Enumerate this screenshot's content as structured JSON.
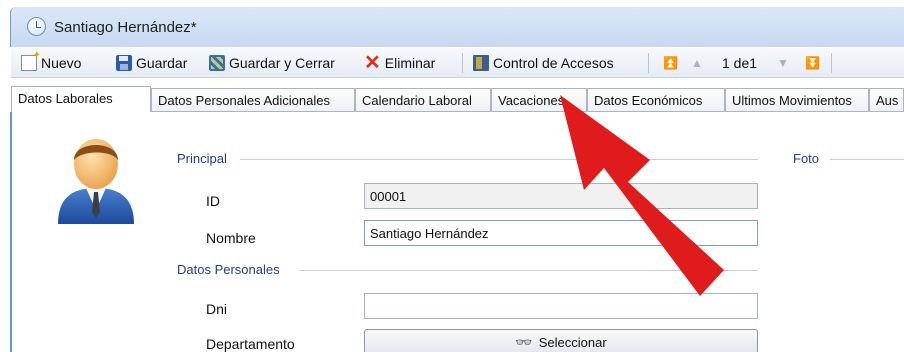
{
  "window": {
    "title": "Santiago Hernández*"
  },
  "toolbar": {
    "nuevo": "Nuevo",
    "guardar": "Guardar",
    "guardar_cerrar": "Guardar y Cerrar",
    "eliminar": "Eliminar",
    "control_accesos": "Control de Accesos",
    "page_indicator": "1 de1"
  },
  "tabs": [
    {
      "label": "Datos Laborales"
    },
    {
      "label": "Datos Personales Adicionales"
    },
    {
      "label": "Calendario Laboral"
    },
    {
      "label": "Vacaciones"
    },
    {
      "label": "Datos Económicos"
    },
    {
      "label": "Ultimos Movimientos"
    },
    {
      "label": "Aus"
    }
  ],
  "form": {
    "principal_group": "Principal",
    "foto_group": "Foto",
    "id_label": "ID",
    "id_value": "00001",
    "nombre_label": "Nombre",
    "nombre_value": "Santiago Hernández",
    "personales_group": "Datos Personales",
    "dni_label": "Dni",
    "dni_value": "",
    "departamento_label": "Departamento",
    "seleccionar_label": "Seleccionar"
  },
  "colors": {
    "annotation_arrow": "#e01b1b",
    "group_label": "#1f3f86",
    "accent": "#6f93c2"
  },
  "icons": [
    "clock-icon",
    "new-document-icon",
    "save-icon",
    "save-close-icon",
    "delete-icon",
    "access-control-icon",
    "first-icon",
    "previous-icon",
    "next-icon",
    "last-icon",
    "user-avatar-icon",
    "binoculars-icon"
  ]
}
